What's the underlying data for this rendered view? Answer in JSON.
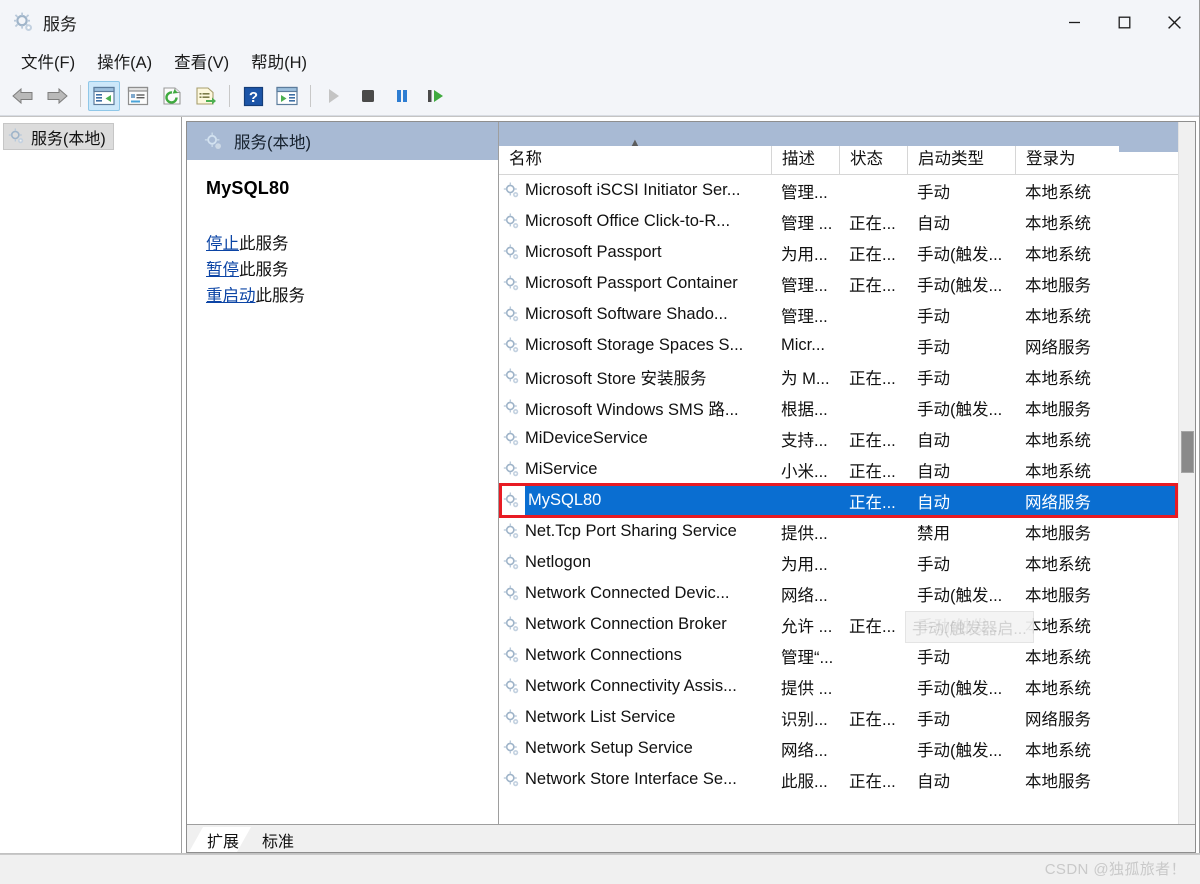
{
  "window": {
    "title": "服务",
    "title_icon": "services-gear-icon",
    "controls": {
      "minimize": "最小化",
      "maximize": "最大化",
      "close": "关闭"
    }
  },
  "menu": {
    "items": [
      {
        "label": "文件(F)",
        "name": "menu-file"
      },
      {
        "label": "操作(A)",
        "name": "menu-action"
      },
      {
        "label": "查看(V)",
        "name": "menu-view"
      },
      {
        "label": "帮助(H)",
        "name": "menu-help"
      }
    ]
  },
  "toolbar": {
    "buttons": [
      {
        "icon": "back-arrow-icon",
        "tip": "后退"
      },
      {
        "icon": "forward-arrow-icon",
        "tip": "前进"
      },
      {
        "icon": "show-hide-console-tree-icon",
        "tip": "显示/隐藏控制台树",
        "active": true
      },
      {
        "icon": "properties-icon",
        "tip": "属性"
      },
      {
        "icon": "refresh-icon",
        "tip": "刷新"
      },
      {
        "icon": "export-list-icon",
        "tip": "导出列表"
      },
      {
        "icon": "help-icon",
        "tip": "帮助"
      },
      {
        "icon": "show-action-pane-icon",
        "tip": "显示/隐藏操作窗格"
      },
      {
        "icon": "start-service-icon",
        "tip": "启动服务"
      },
      {
        "icon": "stop-service-icon",
        "tip": "停止服务"
      },
      {
        "icon": "pause-service-icon",
        "tip": "暂停服务"
      },
      {
        "icon": "restart-service-icon",
        "tip": "重新启动服务"
      }
    ]
  },
  "tree": {
    "items": [
      {
        "label": "服务(本地)",
        "icon": "services-gear-icon",
        "selected": true
      }
    ]
  },
  "detail": {
    "header": "服务(本地)",
    "header_icon": "services-gear-icon",
    "service_title": "MySQL80",
    "links": [
      {
        "link_text": "停止",
        "suffix": "此服务",
        "name": "stop-service-link"
      },
      {
        "link_text": "暂停",
        "suffix": "此服务",
        "name": "pause-service-link"
      },
      {
        "link_text": "重启动",
        "suffix": "此服务",
        "name": "restart-service-link"
      }
    ]
  },
  "list": {
    "columns": [
      {
        "label": "名称",
        "sorted": "asc",
        "name": "column-name"
      },
      {
        "label": "描述",
        "name": "column-description"
      },
      {
        "label": "状态",
        "name": "column-status"
      },
      {
        "label": "启动类型",
        "name": "column-startup-type"
      },
      {
        "label": "登录为",
        "name": "column-log-on-as"
      }
    ],
    "rows": [
      {
        "name": "Microsoft iSCSI Initiator Ser...",
        "description": "管理...",
        "status": "",
        "startup": "手动",
        "logon": "本地系统",
        "selected": false
      },
      {
        "name": "Microsoft Office Click-to-R...",
        "description": "管理 ...",
        "status": "正在...",
        "startup": "自动",
        "logon": "本地系统",
        "selected": false
      },
      {
        "name": "Microsoft Passport",
        "description": "为用...",
        "status": "正在...",
        "startup": "手动(触发...",
        "logon": "本地系统",
        "selected": false
      },
      {
        "name": "Microsoft Passport Container",
        "description": "管理...",
        "status": "正在...",
        "startup": "手动(触发...",
        "logon": "本地服务",
        "selected": false
      },
      {
        "name": "Microsoft Software Shado...",
        "description": "管理...",
        "status": "",
        "startup": "手动",
        "logon": "本地系统",
        "selected": false
      },
      {
        "name": "Microsoft Storage Spaces S...",
        "description": "Micr...",
        "status": "",
        "startup": "手动",
        "logon": "网络服务",
        "selected": false
      },
      {
        "name": "Microsoft Store 安装服务",
        "description": "为 M...",
        "status": "正在...",
        "startup": "手动",
        "logon": "本地系统",
        "selected": false
      },
      {
        "name": "Microsoft Windows SMS 路...",
        "description": "根据...",
        "status": "",
        "startup": "手动(触发...",
        "logon": "本地服务",
        "selected": false
      },
      {
        "name": "MiDeviceService",
        "description": "支持...",
        "status": "正在...",
        "startup": "自动",
        "logon": "本地系统",
        "selected": false
      },
      {
        "name": "MiService",
        "description": "小米...",
        "status": "正在...",
        "startup": "自动",
        "logon": "本地系统",
        "selected": false
      },
      {
        "name": "MySQL80",
        "description": "",
        "status": "正在...",
        "startup": "自动",
        "logon": "网络服务",
        "selected": true
      },
      {
        "name": "Net.Tcp Port Sharing Service",
        "description": "提供...",
        "status": "",
        "startup": "禁用",
        "logon": "本地服务",
        "selected": false
      },
      {
        "name": "Netlogon",
        "description": "为用...",
        "status": "",
        "startup": "手动",
        "logon": "本地系统",
        "selected": false
      },
      {
        "name": "Network Connected Devic...",
        "description": "网络...",
        "status": "",
        "startup": "手动(触发...",
        "logon": "本地服务",
        "selected": false
      },
      {
        "name": "Network Connection Broker",
        "description": "允许 ...",
        "status": "正在...",
        "startup": "手动(触发...",
        "logon": "本地系统",
        "selected": false
      },
      {
        "name": "Network Connections",
        "description": "管理“...",
        "status": "",
        "startup": "手动",
        "logon": "本地系统",
        "selected": false
      },
      {
        "name": "Network Connectivity Assis...",
        "description": "提供 ...",
        "status": "",
        "startup": "手动(触发...",
        "logon": "本地系统",
        "selected": false
      },
      {
        "name": "Network List Service",
        "description": "识别...",
        "status": "正在...",
        "startup": "手动",
        "logon": "网络服务",
        "selected": false
      },
      {
        "name": "Network Setup Service",
        "description": "网络...",
        "status": "",
        "startup": "手动(触发...",
        "logon": "本地系统",
        "selected": false
      },
      {
        "name": "Network Store Interface Se...",
        "description": "此服...",
        "status": "正在...",
        "startup": "自动",
        "logon": "本地服务",
        "selected": false
      }
    ],
    "tooltip": "手动(触发器启..."
  },
  "tabs": [
    {
      "label": "扩展",
      "active": true,
      "name": "tab-extended"
    },
    {
      "label": "标准",
      "active": false,
      "name": "tab-standard"
    }
  ],
  "watermark": "CSDN @独孤旅者！",
  "colors": {
    "selection_blue": "#0a6ed1",
    "header_band": "#a8bad4",
    "annotation_red": "#e81b23",
    "link_blue": "#0b44a5"
  }
}
